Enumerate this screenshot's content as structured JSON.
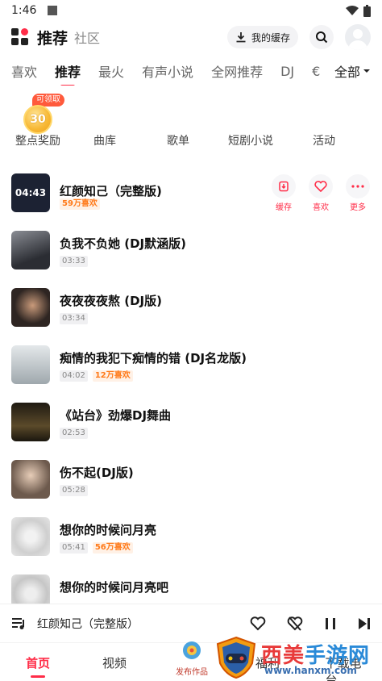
{
  "status_bar": {
    "time": "1:46"
  },
  "header": {
    "title": "推荐",
    "subtitle": "社区",
    "cache_label": "我的缓存"
  },
  "tabs": {
    "items": [
      "喜欢",
      "推荐",
      "最火",
      "有声小说",
      "全网推荐",
      "DJ",
      "€"
    ],
    "more_label": "全部",
    "active_index": 1
  },
  "quick_entries": {
    "coin_value": "30",
    "coin_badge": "可领取",
    "items": [
      "整点奖励",
      "曲库",
      "歌单",
      "短剧小说",
      "活动"
    ]
  },
  "songs": [
    {
      "title": "红颜知己（完整版)",
      "duration": "04:43",
      "likes": "59万喜欢",
      "thumb_color": "#1c2233"
    },
    {
      "title": "负我不负她 (DJ默涵版)",
      "duration": "03:33",
      "likes": "",
      "thumb_color": "#4a4d55"
    },
    {
      "title": "夜夜夜夜熬 (DJ版)",
      "duration": "03:34",
      "likes": "",
      "thumb_color": "#2e2522"
    },
    {
      "title": "痴情的我犯下痴情的错 (DJ名龙版)",
      "duration": "04:02",
      "likes": "12万喜欢",
      "thumb_color": "#a9b3b8"
    },
    {
      "title": "《站台》劲爆DJ舞曲",
      "duration": "02:53",
      "likes": "",
      "thumb_color": "#3b3220"
    },
    {
      "title": "伤不起(DJ版)",
      "duration": "05:28",
      "likes": "",
      "thumb_color": "#7b6e64"
    },
    {
      "title": "想你的时候问月亮",
      "duration": "05:41",
      "likes": "56万喜欢",
      "thumb_color": "#d9d9d9"
    },
    {
      "title": "想你的时候问月亮吧",
      "duration": "",
      "likes": "",
      "thumb_color": "#d0d0d0"
    }
  ],
  "row_actions": {
    "cache": "缓存",
    "like": "喜欢",
    "more": "更多"
  },
  "thumb_overlay_time": "04:43",
  "player": {
    "now_playing": "红颜知己（完整版）"
  },
  "bottom_nav": {
    "items": [
      "首页",
      "视频",
      "福利",
      "下载电台"
    ],
    "publish_label": "发布作品"
  },
  "watermark": {
    "name_left": "西美",
    "name_right": "手游网",
    "url": "www.hanxm.com"
  },
  "colors": {
    "accent": "#ff2d48",
    "hot_tag": "#ff7a1a"
  }
}
